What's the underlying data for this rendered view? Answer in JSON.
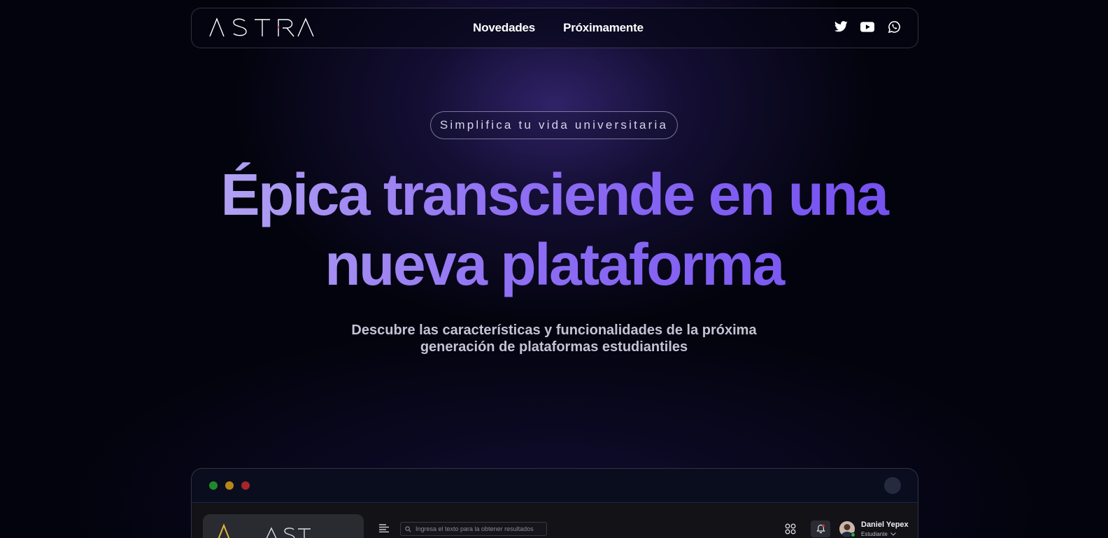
{
  "nav": {
    "logo_text": "ASTRA",
    "links": [
      {
        "label": "Novedades"
      },
      {
        "label": "Próximamente"
      }
    ],
    "socials": [
      "twitter-icon",
      "youtube-icon",
      "whatsapp-icon"
    ]
  },
  "hero": {
    "pill_text": "Simplifica tu vida universitaria",
    "headline": "Épica transciende en una nueva plataforma",
    "subtitle_line1": "Descubre las características y funcionalidades de la próxima",
    "subtitle_line2": "generación de plataformas estudiantiles"
  },
  "preview": {
    "search_placeholder": "Ingresa el texto para la obtener resultados",
    "user_name": "Daniel Yepex",
    "user_role": "Estudiante",
    "logo_text": "ASTRA"
  },
  "colors": {
    "background": "#03030d",
    "headline_start": "#b3a4f2",
    "headline_end": "#7450f0",
    "window_dot_green": "#1f8a2a",
    "window_dot_yellow": "#b8851a",
    "window_dot_red": "#a3262c"
  }
}
